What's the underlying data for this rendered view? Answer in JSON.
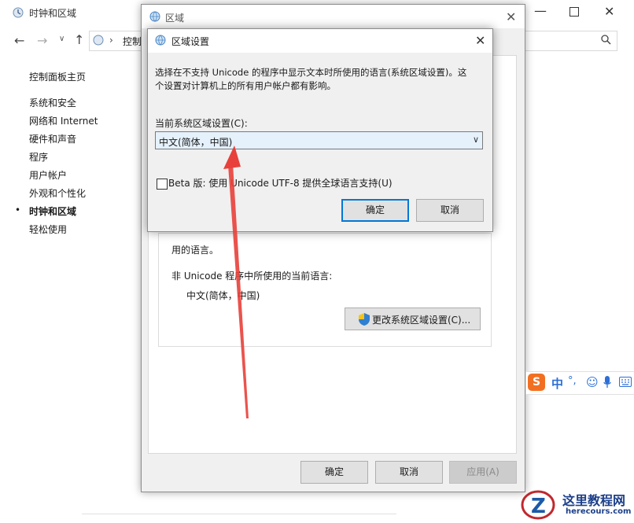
{
  "cp": {
    "title": "时钟和区域",
    "address": "控制",
    "home": "控制面板主页",
    "nav": [
      {
        "label": "系统和安全",
        "active": false
      },
      {
        "label": "网络和 Internet",
        "active": false
      },
      {
        "label": "硬件和声音",
        "active": false
      },
      {
        "label": "程序",
        "active": false
      },
      {
        "label": "用户帐户",
        "active": false
      },
      {
        "label": "外观和个性化",
        "active": false
      },
      {
        "label": "时钟和区域",
        "active": true
      },
      {
        "label": "轻松使用",
        "active": false
      }
    ]
  },
  "region": {
    "title": "区域",
    "partial_text": "用的语言。",
    "non_unicode_label": "非 Unicode 程序中所使用的当前语言:",
    "non_unicode_value": "中文(简体，中国)",
    "change_button": "更改系统区域设置(C)...",
    "ok": "确定",
    "cancel": "取消",
    "apply": "应用(A)"
  },
  "dialog": {
    "title": "区域设置",
    "description_line1": "选择在不支持 Unicode 的程序中显示文本时所使用的语言(系统区域设置)。这",
    "description_line2": "个设置对计算机上的所有用户帐户都有影响。",
    "current_label": "当前系统区域设置(C):",
    "current_value": "中文(简体，中国)",
    "beta_label": "Beta 版: 使用 Unicode UTF-8 提供全球语言支持(U)",
    "beta_checked": false,
    "ok": "确定",
    "cancel": "取消"
  },
  "ime": {
    "logo": "S",
    "mode": "中",
    "punct": "°,"
  },
  "watermark": {
    "title": "这里教程网",
    "url": "herecours.com"
  },
  "colors": {
    "accent": "#0078d7",
    "arrow": "#e8403a",
    "ime_logo": "#f26f21",
    "ime_icons": "#2d6fd6"
  }
}
